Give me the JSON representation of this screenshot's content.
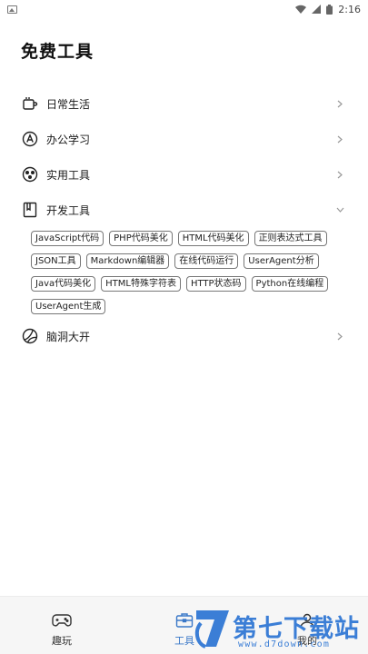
{
  "status_bar": {
    "time": "2:16"
  },
  "page": {
    "title": "免费工具"
  },
  "categories": [
    {
      "label": "日常生活",
      "icon": "cup-icon",
      "expanded": false
    },
    {
      "label": "办公学习",
      "icon": "circle-a-icon",
      "expanded": false
    },
    {
      "label": "实用工具",
      "icon": "dots-circle-icon",
      "expanded": false
    },
    {
      "label": "开发工具",
      "icon": "book-icon",
      "expanded": true
    },
    {
      "label": "脑洞大开",
      "icon": "ball-icon",
      "expanded": false
    }
  ],
  "dev_tools": [
    "JavaScript代码",
    "PHP代码美化",
    "HTML代码美化",
    "正则表达式工具",
    "JSON工具",
    "Markdown编辑器",
    "在线代码运行",
    "UserAgent分析",
    "Java代码美化",
    "HTML特殊字符表",
    "HTTP状态码",
    "Python在线编程",
    "UserAgent生成"
  ],
  "bottom_nav": [
    {
      "label": "趣玩",
      "icon": "gamepad-icon"
    },
    {
      "label": "工具",
      "icon": "toolbox-icon",
      "active": true
    },
    {
      "label": "我的",
      "icon": "user-icon"
    }
  ],
  "watermark": {
    "name": "第七下载站",
    "url": "www.d7down.com"
  },
  "colors": {
    "accent": "#3a78c8",
    "watermark": "#3b7ed6"
  }
}
